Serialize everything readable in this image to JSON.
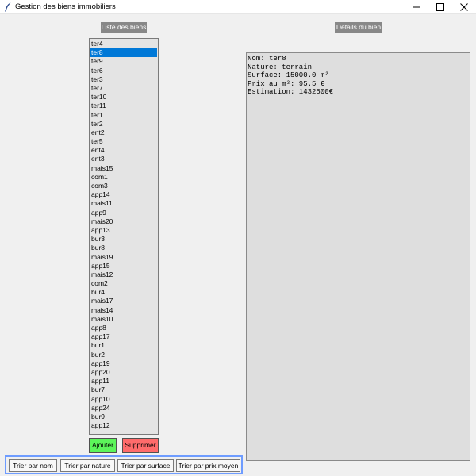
{
  "window": {
    "title": "Gestion des biens immobiliers",
    "icon": "feather-icon"
  },
  "list_panel": {
    "header": "Liste des biens",
    "items": [
      "ter4",
      "ter8",
      "ter9",
      "ter6",
      "ter3",
      "ter7",
      "ter10",
      "ter11",
      "ter1",
      "ter2",
      "ent2",
      "ter5",
      "ent4",
      "ent3",
      "mais15",
      "com1",
      "com3",
      "app14",
      "mais11",
      "app9",
      "mais20",
      "app13",
      "bur3",
      "bur8",
      "mais19",
      "app15",
      "mais12",
      "com2",
      "bur4",
      "mais17",
      "mais14",
      "mais10",
      "app8",
      "app17",
      "bur1",
      "bur2",
      "app19",
      "app20",
      "app11",
      "bur7",
      "app10",
      "app24",
      "bur9",
      "app12"
    ],
    "selected_index": 1
  },
  "actions": {
    "add": "Ajouter",
    "delete": "Supprimer",
    "add_color": "#5cf55a",
    "delete_color": "#ff6b6b"
  },
  "sort": {
    "by_name": "Trier par nom",
    "by_nature": "Trier par nature",
    "by_surface": "Trier par surface",
    "by_price": "Trier par prix moyen",
    "frame_color": "#6e9cff"
  },
  "details_panel": {
    "header": "Détails du bien",
    "lines": [
      "Nom: ter8",
      "Nature: terrain",
      "Surface: 15000.0 m²",
      "Prix au m²: 95.5 €",
      "Estimation: 1432500€"
    ]
  },
  "colors": {
    "selection": "#0078d7",
    "header_bg": "#888888"
  }
}
